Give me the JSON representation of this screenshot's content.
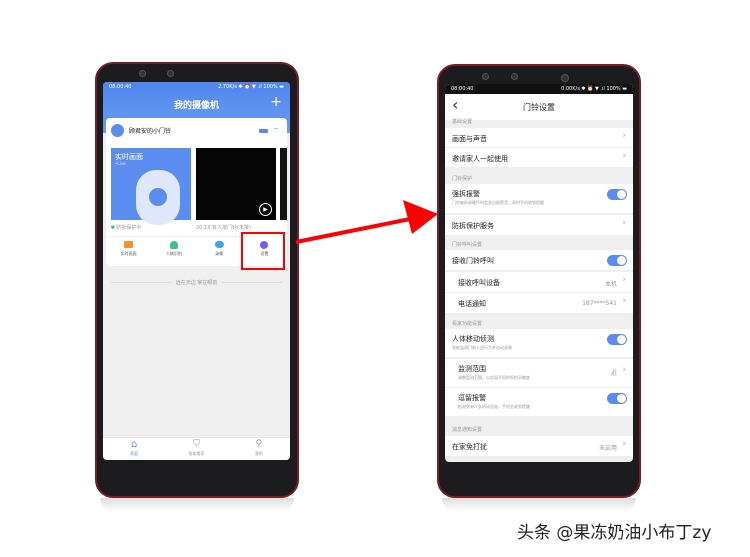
{
  "left": {
    "status": {
      "time": "08:00:40",
      "right": "2.70K/s ✱ ⏰ ▼ .ıl 100% ▬"
    },
    "title": "我的摄像机",
    "add_icon": "+",
    "device": {
      "name": "顾君安的小门铃"
    },
    "live": {
      "title": "实时画面",
      "sub": "•Live"
    },
    "protect_status": "防拆保护中",
    "event_caption": "20:15 有人按门铃(未接)",
    "actions": [
      {
        "label": "实时画面",
        "color": "#f5922f"
      },
      {
        "label": "人物识别",
        "color": "#3fbf8f"
      },
      {
        "label": "录像",
        "color": "#3aa4f0"
      },
      {
        "label": "设置",
        "color": "#7b5cf0"
      }
    ],
    "divider_text": "远在天边 家在眼前",
    "tabs": [
      {
        "label": "家庭",
        "active": true
      },
      {
        "label": "智能看家",
        "active": false
      },
      {
        "label": "我的",
        "active": false
      }
    ]
  },
  "right": {
    "status": {
      "time": "08:00:40",
      "right": "0.00K/s ✱ ⏰ ▼ .ıl 100% ▬"
    },
    "back": "‹",
    "title": "门铃设置",
    "sections": {
      "basic": "基础设置",
      "protect": "门铃保护",
      "call": "门铃呼叫设置",
      "home": "看家功能设置",
      "notify": "消息通知设置"
    },
    "rows": {
      "picture": "画面与声音",
      "invite": "邀请家人一起使用",
      "tamper": {
        "label": "强拆报警",
        "sub": "门铃被拆卸破坏时会发出报警音，同时手机收到提醒",
        "on": true
      },
      "tamper_service": "防拆保护服务",
      "receive": {
        "label": "接收门铃呼叫",
        "on": true
      },
      "device": {
        "label": "接收呼叫设备",
        "value": "本机"
      },
      "phone": {
        "label": "电话通知",
        "value": "187****541"
      },
      "motion": {
        "label": "人体移动侦测",
        "sub": "智能监测门前人员行为并自动录像",
        "on": true
      },
      "range": {
        "label": "监测范围",
        "sub": "调整监测范围，以实现不同的抓拍灵敏度",
        "value": "近"
      },
      "linger": {
        "label": "逗留报警",
        "sub": "检测到有人长时间逗留，手机会收到提醒",
        "on": true
      },
      "dnd": {
        "label": "在家免打扰",
        "value": "未启用"
      }
    }
  },
  "watermark": "头条 @果冻奶油小布丁zy",
  "colors": {
    "accent": "#5b8cf0",
    "highlight": "#ff0000"
  }
}
